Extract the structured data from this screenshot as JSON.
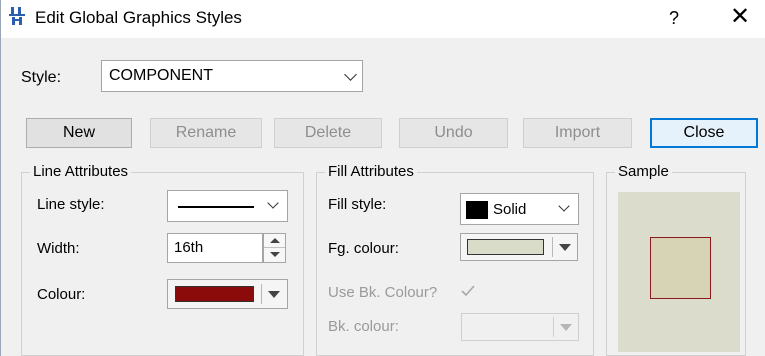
{
  "window": {
    "title": "Edit Global Graphics Styles",
    "help_label": "?",
    "close_glyph": "✕"
  },
  "style": {
    "label": "Style:",
    "value": "COMPONENT"
  },
  "buttons": {
    "new": "New",
    "rename": "Rename",
    "delete": "Delete",
    "undo": "Undo",
    "import": "Import",
    "close": "Close"
  },
  "line_attributes": {
    "title": "Line Attributes",
    "line_style_label": "Line style:",
    "width_label": "Width:",
    "width_value": "16th",
    "colour_label": "Colour:",
    "colour_value": "#8b0a0a"
  },
  "fill_attributes": {
    "title": "Fill Attributes",
    "fill_style_label": "Fill style:",
    "fill_style_value": "Solid",
    "fg_colour_label": "Fg. colour:",
    "fg_colour_value": "#d8dcc8",
    "use_bk_colour_label": "Use Bk. Colour?",
    "use_bk_colour_checked": true,
    "bk_colour_label": "Bk. colour:"
  },
  "sample": {
    "title": "Sample",
    "background": "#dcdccc",
    "fill": "#d6d4b4",
    "border": "#8a1a1a"
  },
  "icons": {
    "app": "graphics-styles-icon",
    "dropdown": "chevron-down-icon",
    "spinner": "spin-updown-icon",
    "check": "checkmark-icon"
  }
}
